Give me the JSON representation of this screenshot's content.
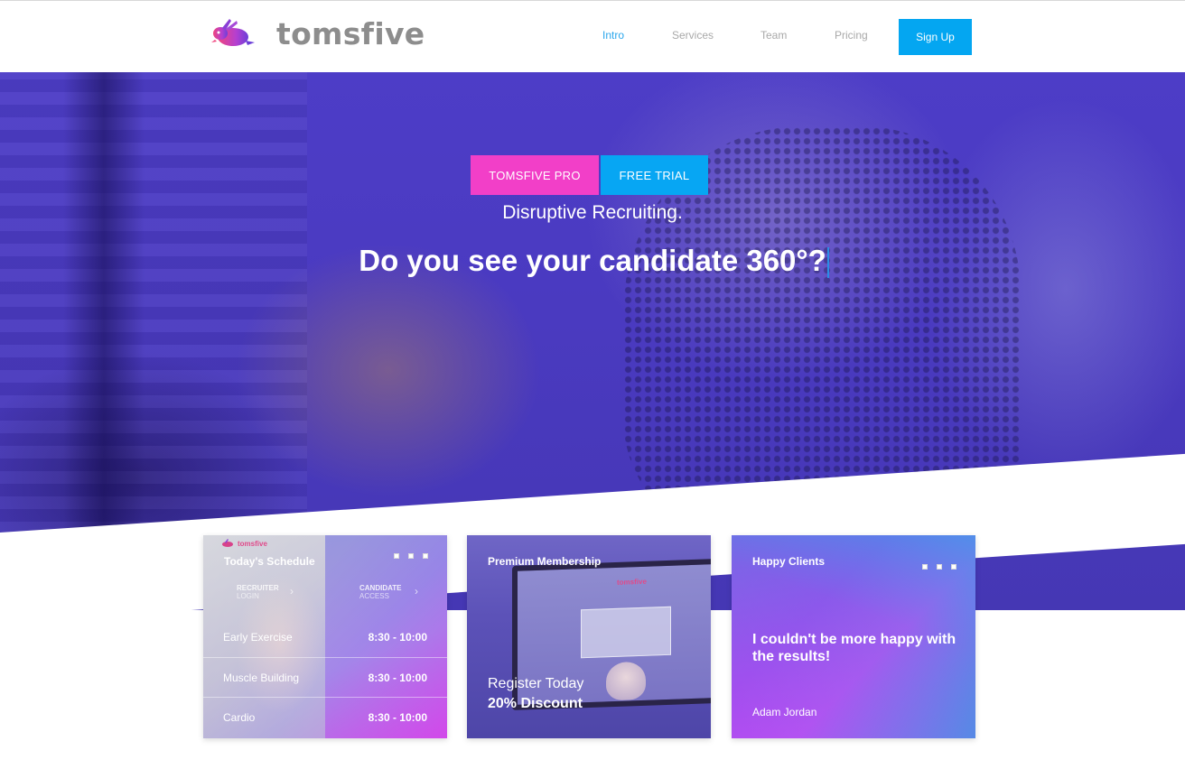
{
  "brand": {
    "name": "tomsfive",
    "logo_icon": "rabbit-logo-icon"
  },
  "nav": {
    "items": [
      {
        "label": "Intro",
        "active": true
      },
      {
        "label": "Services",
        "active": false
      },
      {
        "label": "Team",
        "active": false
      },
      {
        "label": "Pricing",
        "active": false
      }
    ],
    "signup_label": "Sign Up"
  },
  "hero": {
    "badge_pro": "TOMSFIVE PRO",
    "badge_trial": "FREE TRIAL",
    "tagline": "Disruptive Recruiting.",
    "headline": "Do you see your candidate 360°?"
  },
  "cards": {
    "schedule": {
      "title": "Today's Schedule",
      "mini_brand": "tomsfive",
      "recruiter_login": {
        "line1": "RECRUITER",
        "line2": "LOGIN"
      },
      "candidate_access": {
        "line1": "CANDIDATE",
        "line2": "ACCESS"
      },
      "rows": [
        {
          "name": "Early Exercise",
          "time": "8:30 - 10:00"
        },
        {
          "name": "Muscle Building",
          "time": "8:30 - 10:00"
        },
        {
          "name": "Cardio",
          "time": "8:30 - 10:00"
        }
      ]
    },
    "membership": {
      "title": "Premium Membership",
      "screen_brand": "tomsfive",
      "promo_line1": "Register Today",
      "promo_line2": "20% Discount"
    },
    "clients": {
      "title": "Happy Clients",
      "quote": "I couldn't be more happy with the results!",
      "author": "Adam Jordan"
    }
  },
  "colors": {
    "accent_blue": "#04a6f1",
    "accent_pink": "#f23fc8",
    "hero_overlay": "#4d3dc7",
    "nav_active": "#2aa6ec"
  }
}
